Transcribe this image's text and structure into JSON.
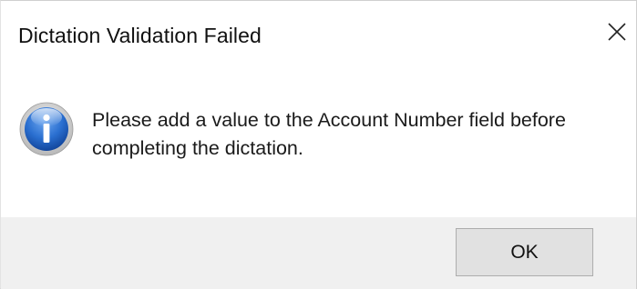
{
  "dialog": {
    "title": "Dictation Validation Failed",
    "close_icon": "close-icon",
    "message_icon": "information-icon",
    "message": "Please add a value to the Account Number field before completing the dictation.",
    "ok_label": "OK"
  },
  "colors": {
    "footer_background": "#f0f0f0",
    "button_background": "#e1e1e1",
    "button_border": "#adadad",
    "icon_blue": "#1f5fbf"
  }
}
